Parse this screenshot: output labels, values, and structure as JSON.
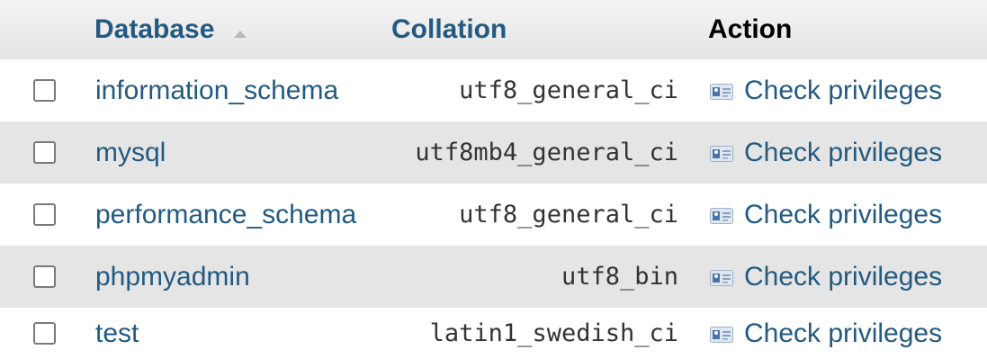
{
  "header": {
    "database_label": "Database",
    "collation_label": "Collation",
    "action_label": "Action"
  },
  "rows": [
    {
      "database": "information_schema",
      "collation": "utf8_general_ci",
      "action": "Check privileges"
    },
    {
      "database": "mysql",
      "collation": "utf8mb4_general_ci",
      "action": "Check privileges"
    },
    {
      "database": "performance_schema",
      "collation": "utf8_general_ci",
      "action": "Check privileges"
    },
    {
      "database": "phpmyadmin",
      "collation": "utf8_bin",
      "action": "Check privileges"
    },
    {
      "database": "test",
      "collation": "latin1_swedish_ci",
      "action": "Check privileges"
    }
  ],
  "colors": {
    "link": "#235a81",
    "header_bg": "#e5e5e5",
    "alt_row_bg": "#e5e5e5"
  },
  "icons": {
    "sort": "sort-ascending-icon",
    "privileges": "privileges-icon"
  }
}
